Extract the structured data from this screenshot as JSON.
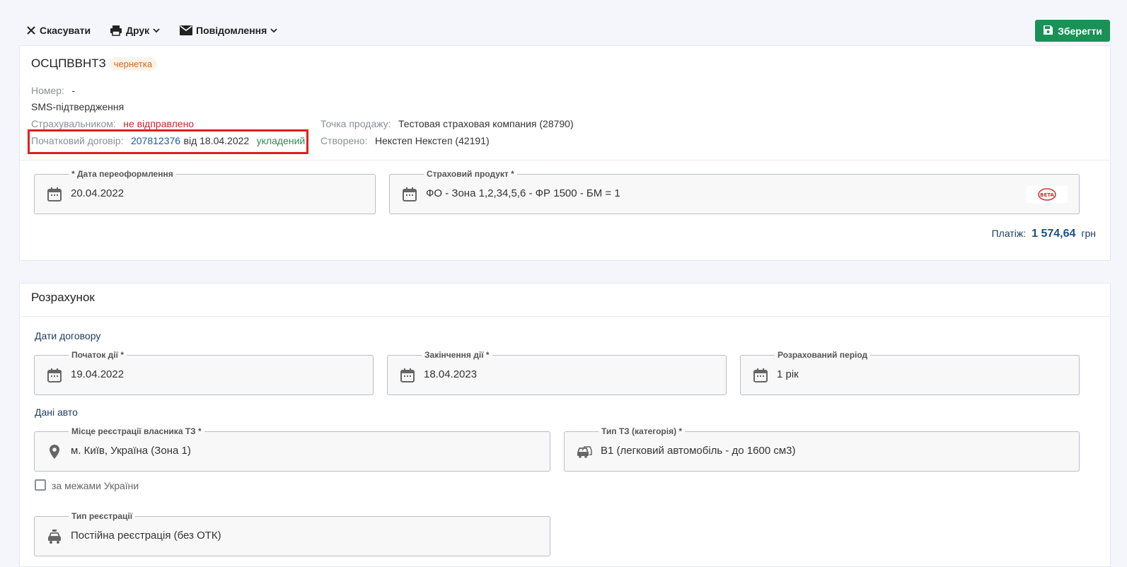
{
  "toolbar": {
    "cancel_label": "Скасувати",
    "print_label": "Друк",
    "notify_label": "Повідомлення",
    "save_label": "Зберегти"
  },
  "header": {
    "title": "ОСЦПВВНТЗ",
    "status_badge": "чернетка"
  },
  "info": {
    "number_label": "Номер:",
    "number_value": "-",
    "sms_label": "SMS-підтвердження",
    "insurer_label": "Страхувальником:",
    "insurer_value": "не відправлено",
    "original_label": "Початковий договір:",
    "original_number": "207812376",
    "original_date": "від 18.04.2022",
    "original_status": "укладений",
    "sale_point_label": "Точка продажу:",
    "sale_point_value": "Тестовая страховая компания (28790)",
    "created_label": "Створено:",
    "created_value": "Некстеп Некстеп (42191)"
  },
  "fields": {
    "reissue_date": {
      "label": "* Дата переоформлення",
      "value": "20.04.2022",
      "icon": "calendar-icon"
    },
    "product": {
      "label": "Страховий продукт *",
      "value": "ФО - Зона 1,2,34,5,6 - ФР 1500 - БМ = 1",
      "icon": "calendar-icon",
      "badge": "BETA"
    }
  },
  "payment": {
    "label": "Платіж:",
    "amount": "1 574,64",
    "currency": "грн"
  },
  "calc": {
    "title": "Розрахунок",
    "dates_section": "Дати договору",
    "start": {
      "label": "Початок дії *",
      "value": "19.04.2022"
    },
    "end": {
      "label": "Закінчення дії *",
      "value": "18.04.2023"
    },
    "period": {
      "label": "Розрахований період",
      "value": "1 рік"
    },
    "car_section": "Дані авто",
    "reg_place": {
      "label": "Місце реєстрації власника ТЗ *",
      "value": "м. Київ, Україна (Зона 1)",
      "icon": "location-pin-icon"
    },
    "vehicle_type": {
      "label": "Тип ТЗ (категорія) *",
      "value": "B1 (легковий автомобіль - до 1600 см3)",
      "icon": "car-icon"
    },
    "abroad_label": "за межами України",
    "abroad_checked": false,
    "reg_type": {
      "label": "Тип реєстрації",
      "value": "Постійна реєстрація (без ОТК)",
      "icon": "taxi-icon"
    }
  },
  "colors": {
    "primary_green": "#1a9156",
    "link_blue": "#1e5aa0",
    "draft_orange": "#d26a1e",
    "error_red": "#c62828",
    "highlight_red": "#e31f1f"
  }
}
